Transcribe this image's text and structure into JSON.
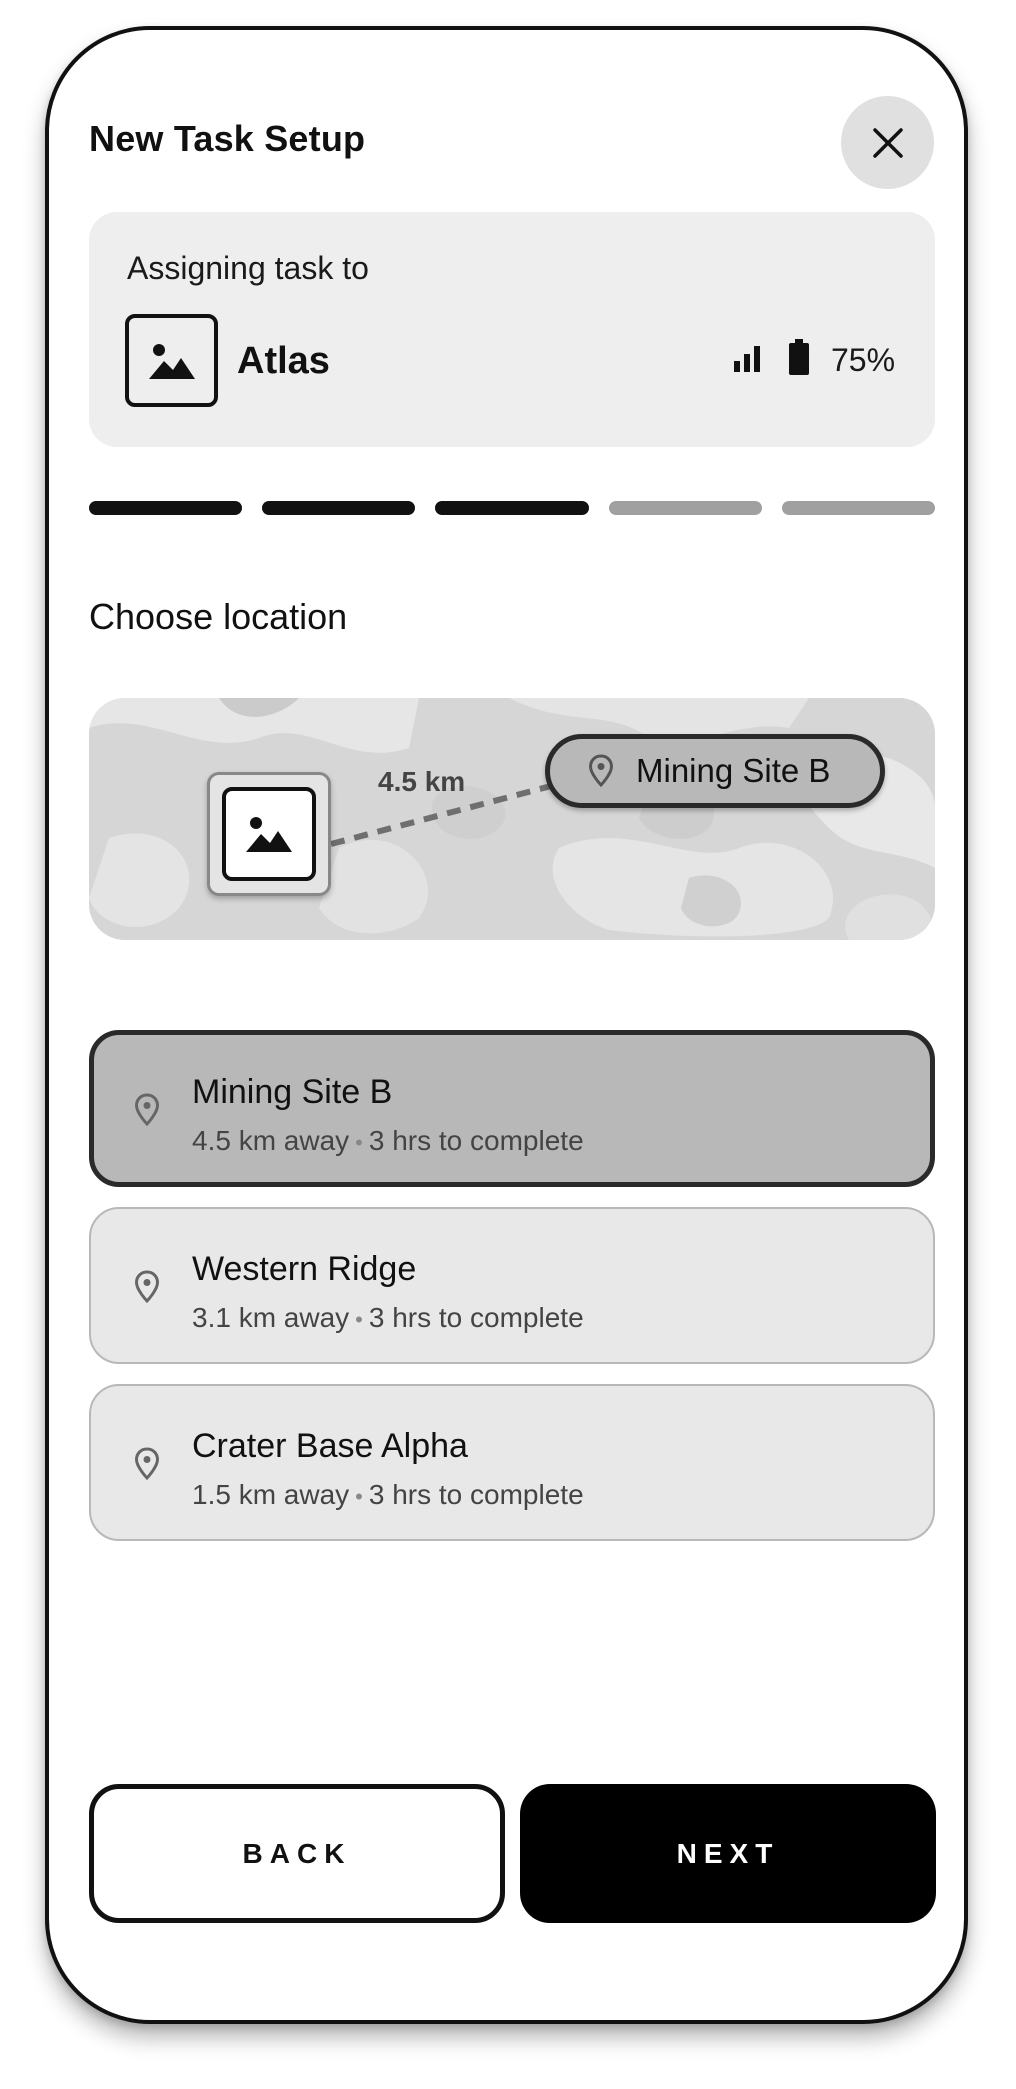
{
  "header": {
    "title": "New Task Setup",
    "close_icon": "close-icon"
  },
  "assignment": {
    "label": "Assigning task to",
    "robot_name": "Atlas",
    "signal_icon": "signal-bars-icon",
    "battery_icon": "battery-icon",
    "battery_percent": "75%"
  },
  "progress": {
    "total_steps": 5,
    "completed_steps": 3,
    "active_color": "#111111",
    "inactive_color": "#a0a0a0"
  },
  "section": {
    "title": "Choose location"
  },
  "map": {
    "distance_label": "4.5 km",
    "destination_label": "Mining Site B"
  },
  "locations": [
    {
      "name": "Mining Site B",
      "distance": "4.5 km away",
      "separator": "•",
      "duration": "3 hrs to complete",
      "selected": true
    },
    {
      "name": "Western Ridge",
      "distance": "3.1 km away",
      "separator": "•",
      "duration": "3 hrs to complete",
      "selected": false
    },
    {
      "name": "Crater Base Alpha",
      "distance": "1.5 km away",
      "separator": "•",
      "duration": "3 hrs to complete",
      "selected": false
    }
  ],
  "footer": {
    "back_label": "BACK",
    "next_label": "NEXT"
  }
}
